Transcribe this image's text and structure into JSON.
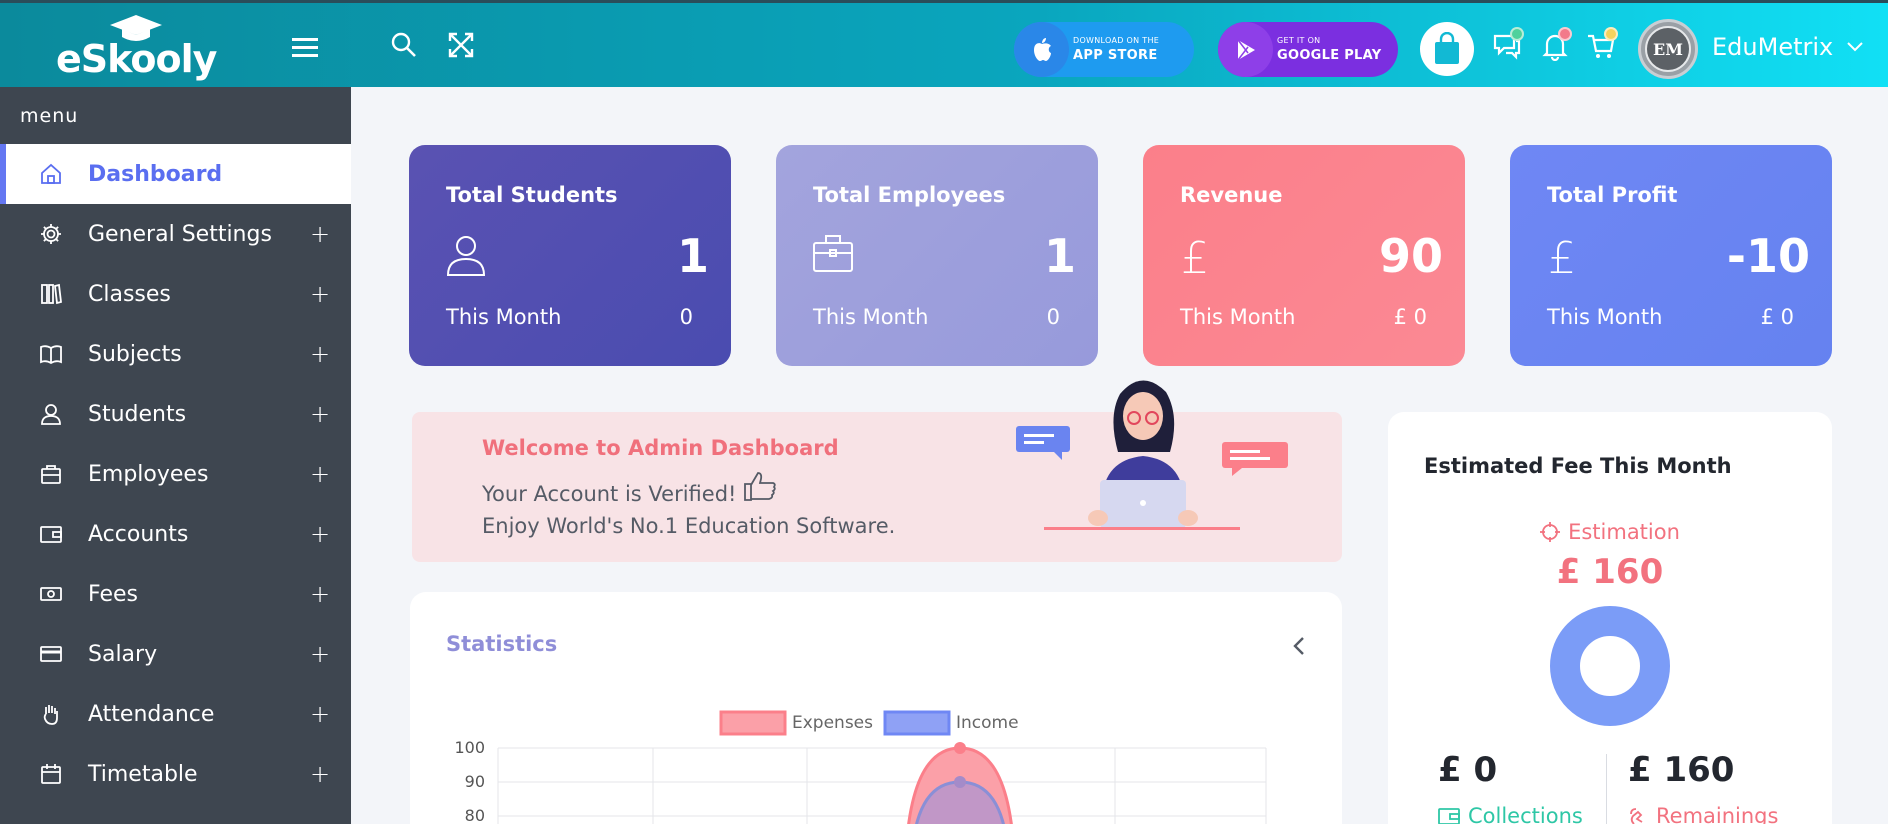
{
  "header": {
    "logo_text": "eSkooly",
    "app_store": {
      "small": "DOWNLOAD ON THE",
      "big": "APP STORE"
    },
    "google_play": {
      "small": "GET IT ON",
      "big": "GOOGLE PLAY"
    },
    "user_name": "EduMetrix",
    "avatar_initials": "EM",
    "colors": {
      "gradient_start": "#0b8a9c",
      "gradient_end": "#11e0f5",
      "app_store": "#1e9bf0",
      "google_play": "#7b2fe0"
    }
  },
  "sidebar": {
    "menu_label": "menu",
    "items": [
      {
        "label": "Dashboard",
        "icon": "home-icon",
        "active": true
      },
      {
        "label": "General Settings",
        "icon": "gear-icon"
      },
      {
        "label": "Classes",
        "icon": "classes-icon"
      },
      {
        "label": "Subjects",
        "icon": "book-icon"
      },
      {
        "label": "Students",
        "icon": "user-icon"
      },
      {
        "label": "Employees",
        "icon": "briefcase-icon"
      },
      {
        "label": "Accounts",
        "icon": "wallet-icon"
      },
      {
        "label": "Fees",
        "icon": "money-icon"
      },
      {
        "label": "Salary",
        "icon": "card-icon"
      },
      {
        "label": "Attendance",
        "icon": "hand-icon"
      },
      {
        "label": "Timetable",
        "icon": "calendar-icon"
      }
    ],
    "plus": "+"
  },
  "cards": [
    {
      "title": "Total Students",
      "value": "1",
      "sub": "This Month",
      "subval": "0",
      "color": "#5a52b2"
    },
    {
      "title": "Total Employees",
      "value": "1",
      "sub": "This Month",
      "subval": "0",
      "color": "#9ea2dc"
    },
    {
      "title": "Revenue",
      "value": "90",
      "sub": "This Month",
      "subval": "£ 0",
      "symbol": "£",
      "color": "#fb7f8a"
    },
    {
      "title": "Total Profit",
      "value": "-10",
      "sub": "This Month",
      "subval": "£ 0",
      "symbol": "£",
      "color": "#6f87f4"
    }
  ],
  "welcome": {
    "title": "Welcome to Admin Dashboard",
    "line1": "Your Account is Verified!",
    "line2": "Enjoy World's No.1 Education Software."
  },
  "statistics": {
    "title": "Statistics",
    "chart_data": {
      "type": "area",
      "series": [
        {
          "name": "Expenses",
          "color": "#fb7f8a"
        },
        {
          "name": "Income",
          "color": "#6f87f4"
        }
      ],
      "y_ticks": [
        "100",
        "90",
        "80"
      ],
      "peak": {
        "Expenses": 100,
        "Income": 90
      },
      "grid": true,
      "legend": "top-center"
    }
  },
  "fee": {
    "title": "Estimated Fee This Month",
    "estimation_label": "Estimation",
    "estimation_value": "£ 160",
    "collections_value": "£ 0",
    "collections_label": "Collections",
    "remainings_value": "£ 160",
    "remainings_label": "Remainings",
    "donut_fraction_collected": 0
  }
}
